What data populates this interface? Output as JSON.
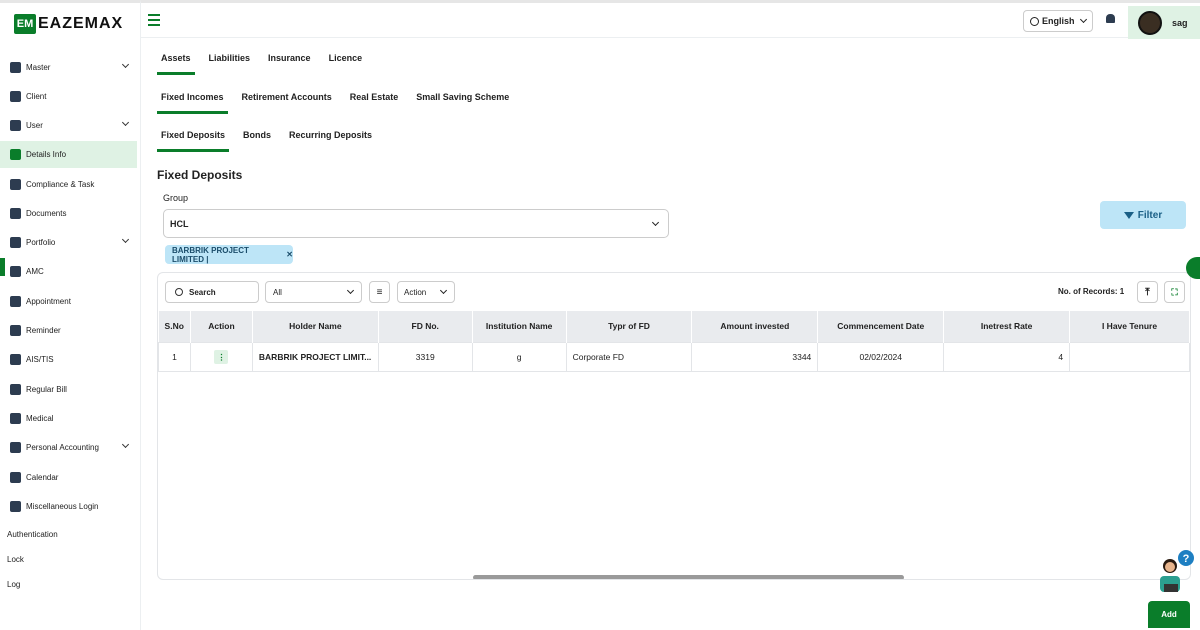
{
  "brand": {
    "mark": "EM",
    "name": "EAZEMAX"
  },
  "sidebar": {
    "items": [
      {
        "label": "Master",
        "icon": "master-icon",
        "chevron": true
      },
      {
        "label": "Client",
        "icon": "client-icon",
        "chevron": false
      },
      {
        "label": "User",
        "icon": "user-icon",
        "chevron": true
      },
      {
        "label": "Details Info",
        "icon": "details-icon",
        "chevron": false,
        "active": true
      },
      {
        "label": "Compliance & Task",
        "icon": "compliance-icon",
        "chevron": false
      },
      {
        "label": "Documents",
        "icon": "documents-icon",
        "chevron": false
      },
      {
        "label": "Portfolio",
        "icon": "portfolio-icon",
        "chevron": true
      },
      {
        "label": "AMC",
        "icon": "amc-icon",
        "chevron": false
      },
      {
        "label": "Appointment",
        "icon": "appointment-icon",
        "chevron": false
      },
      {
        "label": "Reminder",
        "icon": "reminder-icon",
        "chevron": false
      },
      {
        "label": "AIS/TIS",
        "icon": "ais-icon",
        "chevron": false
      },
      {
        "label": "Regular Bill",
        "icon": "bill-icon",
        "chevron": false
      },
      {
        "label": "Medical",
        "icon": "medical-icon",
        "chevron": false
      },
      {
        "label": "Personal Accounting",
        "icon": "accounting-icon",
        "chevron": true
      },
      {
        "label": "Calendar",
        "icon": "calendar-icon",
        "chevron": false
      },
      {
        "label": "Miscellaneous Login",
        "icon": "misc-login-icon",
        "chevron": false
      }
    ],
    "plain": [
      "Authentication",
      "Lock",
      "Log"
    ]
  },
  "topbar": {
    "language": "English",
    "username": "sag"
  },
  "tabs": {
    "level1": [
      "Assets",
      "Liabilities",
      "Insurance",
      "Licence"
    ],
    "level2": [
      "Fixed Incomes",
      "Retirement Accounts",
      "Real Estate",
      "Small Saving Scheme"
    ],
    "level3": [
      "Fixed Deposits",
      "Bonds",
      "Recurring Deposits"
    ]
  },
  "section": {
    "title": "Fixed Deposits",
    "group_label": "Group",
    "group_value": "HCL",
    "chip": "BARBRIK PROJECT LIMITED |",
    "filter": "Filter"
  },
  "toolbar": {
    "search_placeholder": "Search",
    "all": "All",
    "action": "Action",
    "records": "No. of Records: 1"
  },
  "table": {
    "columns": [
      "S.No",
      "Action",
      "Holder Name",
      "FD No.",
      "Institution Name",
      "Typr of FD",
      "Amount invested",
      "Commencement Date",
      "Inetrest Rate",
      "I Have Tenure"
    ],
    "rows": [
      [
        "1",
        "⋮",
        "BARBRIK PROJECT LIMIT...",
        "3319",
        "g",
        "Corporate FD",
        "3344",
        "02/02/2024",
        "4",
        ""
      ]
    ]
  },
  "add_label": "Add",
  "colors": {
    "accent": "#0a7d2a",
    "active_bg": "#dff2e4",
    "chip_bg": "#bde5f7"
  }
}
